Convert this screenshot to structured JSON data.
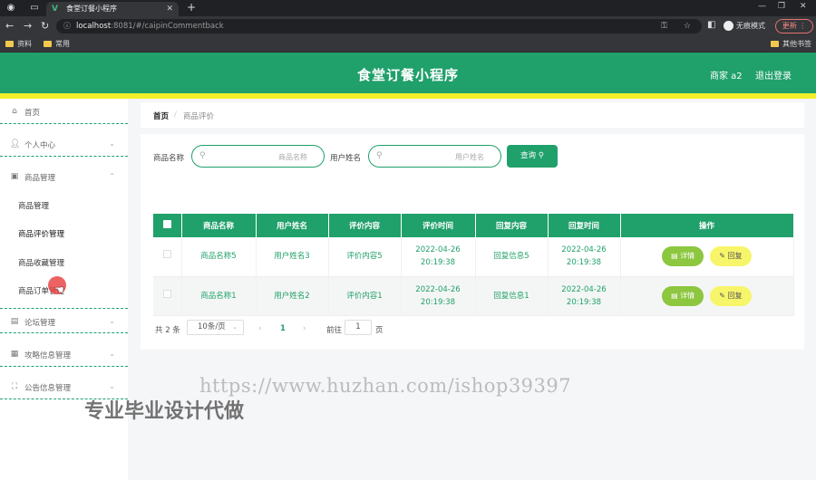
{
  "browser": {
    "tab_title": "食堂订餐小程序",
    "url_host": "localhost",
    "url_path": ":8081/#/caipinCommentback",
    "incognito_label": "无痕模式",
    "update_label": "更新",
    "bookmarks": [
      "资料",
      "常用",
      "其他书签"
    ]
  },
  "header": {
    "title": "食堂订餐小程序",
    "user": "商家 a2",
    "logout": "退出登录"
  },
  "sidebar": {
    "items": [
      {
        "label": "首页",
        "icon": "home-icon"
      },
      {
        "label": "个人中心",
        "icon": "person-icon"
      },
      {
        "label": "商品管理",
        "icon": "briefcase-icon"
      },
      {
        "label": "论坛管理",
        "icon": "forum-icon"
      },
      {
        "label": "攻略信息管理",
        "icon": "clipboard-icon"
      },
      {
        "label": "公告信息管理",
        "icon": "notice-icon"
      }
    ],
    "sub_items": [
      "商品管理",
      "商品评价管理",
      "商品收藏管理",
      "商品订单管理"
    ]
  },
  "breadcrumb": {
    "home": "首页",
    "separator": "/",
    "current": "商品评价"
  },
  "search": {
    "name_label": "商品名称",
    "name_placeholder": "商品名称",
    "user_label": "用户姓名",
    "user_placeholder": "用户姓名",
    "query_button": "查询"
  },
  "table": {
    "headers": [
      "商品名称",
      "用户姓名",
      "评价内容",
      "评价时间",
      "回复内容",
      "回复时间",
      "操作"
    ],
    "rows": [
      {
        "name": "商品名称5",
        "user": "用户姓名3",
        "content": "评价内容5",
        "time": "2022-04-26 20:19:38",
        "reply": "回复信息5",
        "reply_time": "2022-04-26 20:19:38"
      },
      {
        "name": "商品名称1",
        "user": "用户姓名2",
        "content": "评价内容1",
        "time": "2022-04-26 20:19:38",
        "reply": "回复信息1",
        "reply_time": "2022-04-26 20:19:38"
      }
    ],
    "detail_label": "详情",
    "reply_label": "回复"
  },
  "pagination": {
    "total": "共 2 条",
    "page_size": "10条/页",
    "current_page": "1",
    "goto_label": "前往",
    "goto_value": "1",
    "page_suffix": "页"
  },
  "watermark": {
    "url": "https://www.huzhan.com/ishop39397",
    "text": "专业毕业设计代做"
  },
  "colors": {
    "primary": "#20a06b",
    "accent_yellow": "#f2ef2a",
    "detail_btn": "#8dc63f",
    "reply_btn": "#f7f56a"
  }
}
